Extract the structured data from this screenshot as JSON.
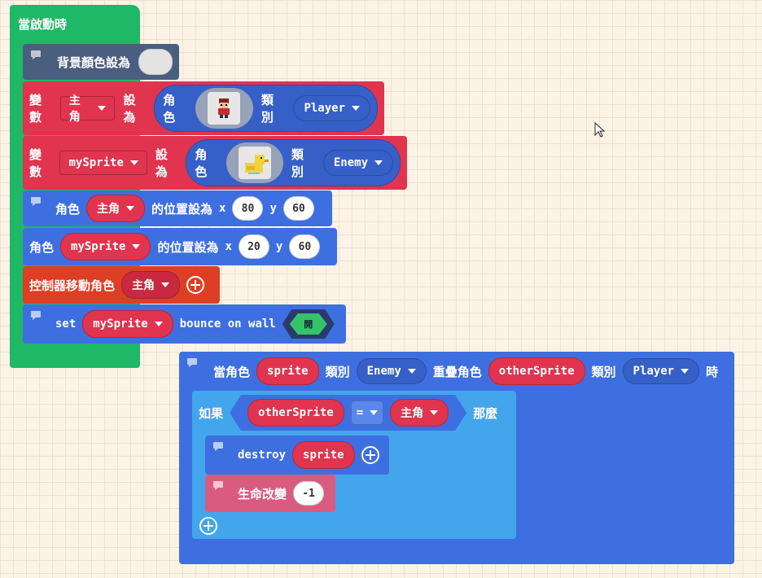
{
  "hat": {
    "label": "當啟動時"
  },
  "bg_block": {
    "label": "背景顏色設為"
  },
  "var1": {
    "var_word": "變數",
    "var_name": "主角",
    "set_word": "設為",
    "sprite_word": "角色",
    "kind_word": "類別",
    "kind_value": "Player"
  },
  "var2": {
    "var_word": "變數",
    "var_name": "mySprite",
    "set_word": "設為",
    "sprite_word": "角色",
    "kind_word": "類別",
    "kind_value": "Enemy"
  },
  "pos1": {
    "sprite_word": "角色",
    "sprite_name": "主角",
    "label": "的位置設為",
    "x_label": "x",
    "x_value": "80",
    "y_label": "y",
    "y_value": "60"
  },
  "pos2": {
    "sprite_word": "角色",
    "sprite_name": "mySprite",
    "label": "的位置設為",
    "x_label": "x",
    "x_value": "20",
    "y_label": "y",
    "y_value": "60"
  },
  "controller": {
    "label": "控制器移動角色",
    "sprite_name": "主角"
  },
  "bounce": {
    "set_word": "set",
    "sprite_name": "mySprite",
    "label": "bounce on wall",
    "toggle_label": "開"
  },
  "overlap": {
    "label": "當角色",
    "sprite_name": "sprite",
    "kind_word": "類別",
    "kind_value": "Enemy",
    "label2": "重疊角色",
    "other_name": "otherSprite",
    "kind_word2": "類別",
    "kind_value2": "Player",
    "label3": "時"
  },
  "if_block": {
    "if_word": "如果",
    "left": "otherSprite",
    "op": "=",
    "right": "主角",
    "then_word": "那麼"
  },
  "destroy": {
    "label": "destroy",
    "sprite_name": "sprite"
  },
  "life": {
    "label": "生命改變",
    "value": "-1"
  }
}
